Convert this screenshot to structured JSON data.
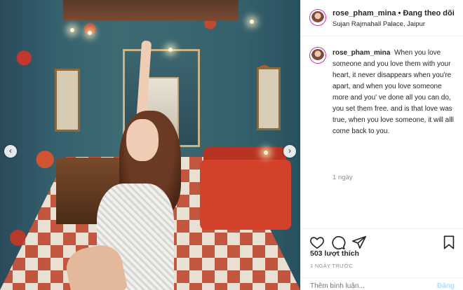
{
  "post": {
    "username": "rose_pham_mina",
    "follow_status": "Đang theo dõi",
    "separator": "•",
    "location": "Sujan Rajmahall Palace, Jaipur"
  },
  "caption": {
    "username": "rose_pham_mina",
    "text": "When you love someone and you love them with your heart, it never disappears when you're apart, and when you love someone more and you' ve done all you can do, you set them free. and is that love was true, when you love someone, it will alll come back to you.",
    "time_ago": "1 ngày"
  },
  "actions": {
    "like_icon": "heart-icon",
    "comment_icon": "comment-icon",
    "share_icon": "share-icon",
    "save_icon": "bookmark-icon"
  },
  "stats": {
    "likes": "503 lượt thích",
    "date": "1 NGÀY TRƯỚC"
  },
  "comment_box": {
    "placeholder": "Thêm bình luận...",
    "post_label": "Đăng"
  },
  "carousel": {
    "prev_icon": "chevron-left-icon",
    "next_icon": "chevron-right-icon",
    "prev_glyph": "‹",
    "next_glyph": "›"
  }
}
